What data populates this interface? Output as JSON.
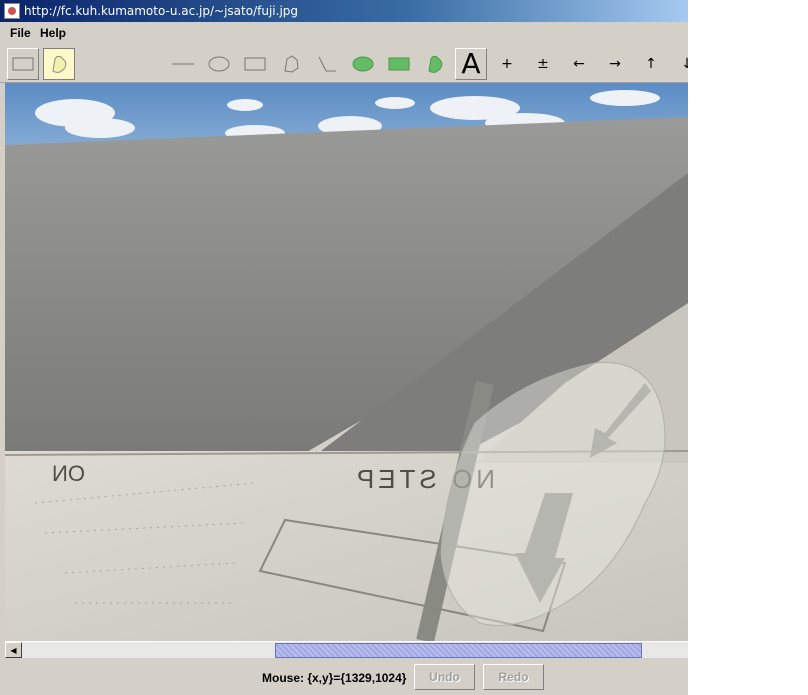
{
  "window": {
    "title": "http://fc.kuh.kumamoto-u.ac.jp/~jsato/fuji.jpg"
  },
  "menu": {
    "items": [
      "File",
      "Help"
    ]
  },
  "toolbar": {
    "tools": [
      {
        "name": "select-rect-tool",
        "icon": "rectangle-outline-icon",
        "selected": false
      },
      {
        "name": "select-freeform-tool",
        "icon": "freeform-outline-icon",
        "selected": true
      },
      {
        "name": "line-tool",
        "icon": "line-icon"
      },
      {
        "name": "ellipse-tool",
        "icon": "ellipse-outline-icon"
      },
      {
        "name": "rectangle-tool",
        "icon": "rectangle-outline-icon"
      },
      {
        "name": "polygon-tool",
        "icon": "polygon-outline-icon"
      },
      {
        "name": "polyline-tool",
        "icon": "polyline-icon"
      },
      {
        "name": "filled-ellipse-tool",
        "icon": "filled-ellipse-icon"
      },
      {
        "name": "filled-rectangle-tool",
        "icon": "filled-rectangle-icon"
      },
      {
        "name": "filled-polygon-tool",
        "icon": "filled-polygon-icon"
      },
      {
        "name": "text-tool",
        "icon": "text-icon",
        "label": "A"
      }
    ],
    "nav_buttons": [
      "+",
      "±",
      "←",
      "→",
      "↑",
      "↓"
    ],
    "fill_color": "#66bb66"
  },
  "status": {
    "mouse_label": "Mouse: {x,y}={1329,1024}",
    "undo_label": "Undo",
    "redo_label": "Redo"
  },
  "image": {
    "wing_text_left": "ON",
    "wing_text_main": "NO STEP"
  },
  "scrollbar": {
    "left_arrow": "◀"
  }
}
